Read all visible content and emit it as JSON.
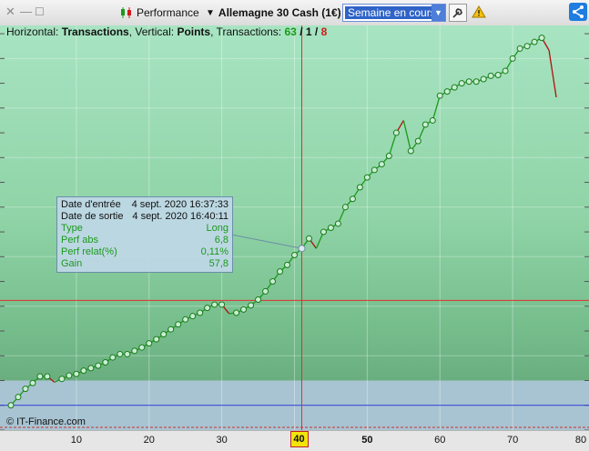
{
  "titlebar": {
    "performance_label": "Performance",
    "instrument": "Allemagne 30 Cash (1€)",
    "period": "Semaine en cours",
    "icons": [
      "close-icon",
      "minimize-icon",
      "maximize-icon",
      "candlestick-icon",
      "dropdown-icon",
      "wrench-icon",
      "warning-icon",
      "share-icon"
    ]
  },
  "info": {
    "horizontal_label": "Horizontal:",
    "horizontal_value": "Transactions",
    "vertical_label": ", Vertical:",
    "vertical_value": "Points",
    "transactions_label": ", Transactions:",
    "win": "63",
    "sep1": "/",
    "neutral": "1",
    "sep2": "/",
    "loss": "8"
  },
  "tooltip": {
    "entry_label": "Date d'entrée",
    "entry_value": "4 sept. 2020 16:37:33",
    "exit_label": "Date de sortie",
    "exit_value": "4 sept. 2020 16:40:11",
    "type_label": "Type",
    "type_value": "Long",
    "perf_abs_label": "Perf abs",
    "perf_abs_value": "6,8",
    "perf_rel_label": "Perf relat(%)",
    "perf_rel_value": "0,11%",
    "gain_label": "Gain",
    "gain_value": "57,8"
  },
  "copyright": "© IT-Finance.com",
  "colors": {
    "win": "#1a9a1a",
    "loss": "#b01010",
    "zero_line": "#2a3ad6",
    "crosshair": "#e03030"
  },
  "chart_data": {
    "type": "line",
    "xlabel": "",
    "ylabel": "",
    "xlim": [
      0,
      80
    ],
    "ylim": [
      -30,
      460
    ],
    "x_ticks": [
      "10",
      "20",
      "30",
      "40",
      "50",
      "60",
      "70",
      "80"
    ],
    "x_highlight": "40",
    "crosshair_x": 41,
    "crosshair_y": 127,
    "zero_level": 0,
    "series": [
      {
        "values": [
          0,
          10,
          20,
          27,
          35,
          35,
          28,
          32,
          36,
          38,
          42,
          45,
          48,
          52,
          58,
          62,
          62,
          66,
          70,
          75,
          80,
          86,
          92,
          98,
          104,
          108,
          112,
          118,
          122,
          122,
          111,
          112,
          116,
          121,
          128,
          138,
          150,
          162,
          170,
          182,
          190,
          202,
          190,
          210,
          215,
          220,
          240,
          250,
          264,
          276,
          285,
          292,
          302,
          330,
          345,
          308,
          320,
          340,
          345,
          375,
          380,
          385,
          390,
          392,
          392,
          395,
          399,
          400,
          405,
          420,
          432,
          435,
          440,
          445,
          430,
          373
        ],
        "loss_indices": [
          6,
          30,
          42,
          54,
          74,
          75
        ]
      }
    ]
  }
}
